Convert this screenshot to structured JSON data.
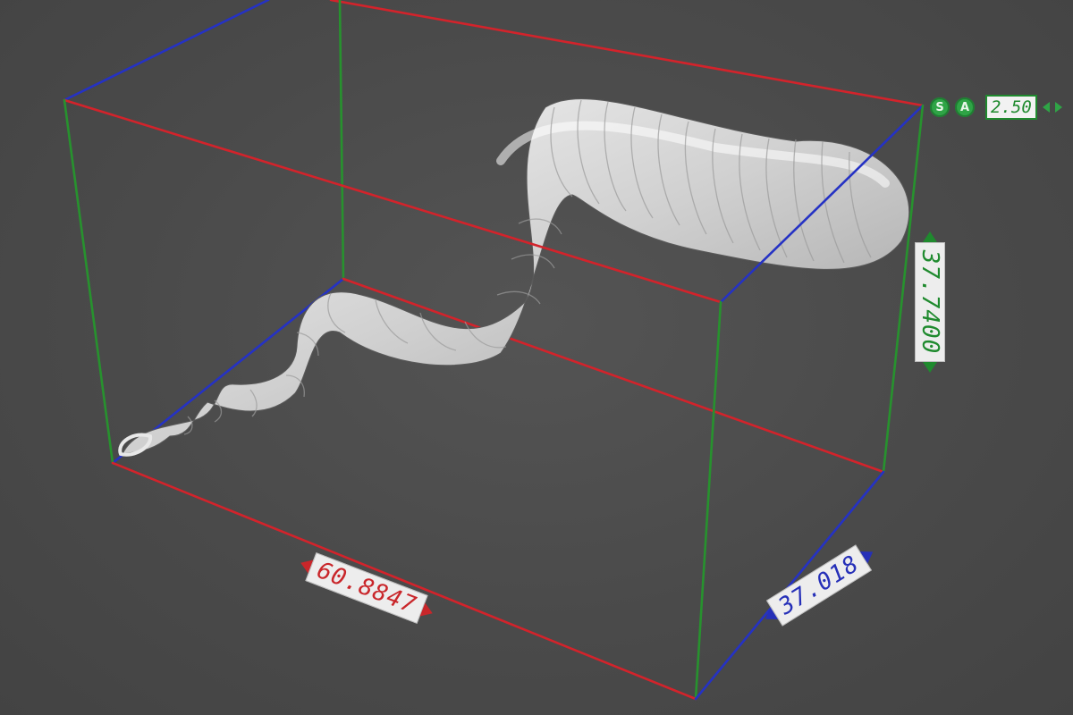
{
  "viewport": {
    "background": "#4b4b4b",
    "model": "worm-shaped 3D mesh"
  },
  "bounding_box": {
    "colors": {
      "x_axis": "#d3232b",
      "y_axis": "#27922e",
      "z_axis": "#2532c4"
    }
  },
  "dimensions": {
    "width_label": "60.8847",
    "height_label": "37.7400",
    "depth_label": "37.018"
  },
  "toolbar": {
    "s_button": "S",
    "a_button": "A",
    "value": "2.50",
    "icons": [
      "snap-icon",
      "angle-icon",
      "decrement-arrow-icon",
      "increment-arrow-icon"
    ]
  }
}
